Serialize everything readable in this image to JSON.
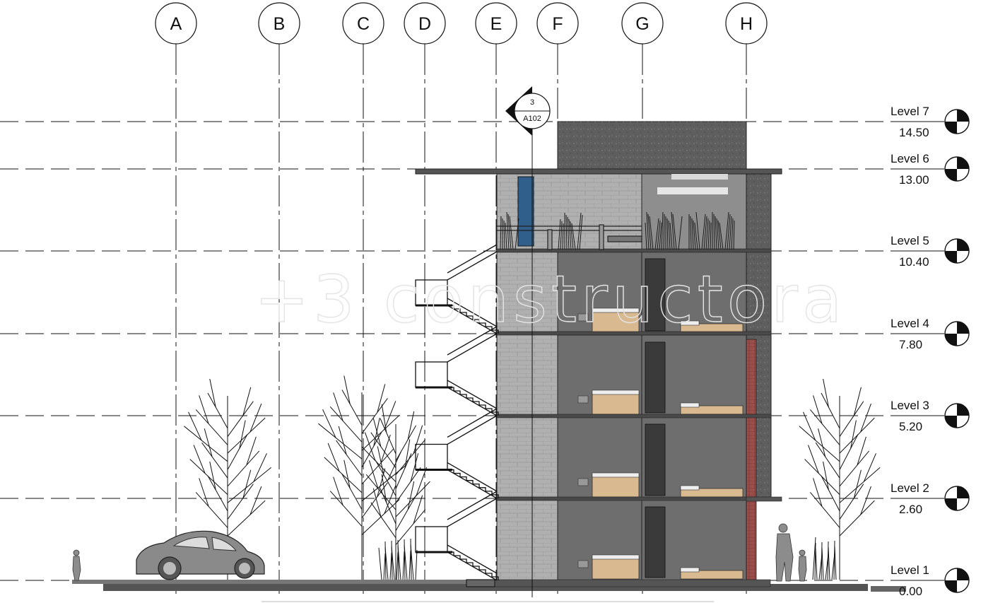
{
  "grids": [
    {
      "label": "A"
    },
    {
      "label": "B"
    },
    {
      "label": "C"
    },
    {
      "label": "D"
    },
    {
      "label": "E"
    },
    {
      "label": "F"
    },
    {
      "label": "G"
    },
    {
      "label": "H"
    }
  ],
  "levels": [
    {
      "name": "Level 7",
      "elevation": "14.50"
    },
    {
      "name": "Level 6",
      "elevation": "13.00"
    },
    {
      "name": "Level 5",
      "elevation": "10.40"
    },
    {
      "name": "Level 4",
      "elevation": "7.80"
    },
    {
      "name": "Level 3",
      "elevation": "5.20"
    },
    {
      "name": "Level 2",
      "elevation": "2.60"
    },
    {
      "name": "Level 1",
      "elevation": "0.00"
    }
  ],
  "section_marker": {
    "number": "3",
    "sheet": "A102"
  },
  "watermark": "+3 constructora",
  "colors": {
    "line": "#111111",
    "slab": "#4a4a4a",
    "block_wall": "#a9a9a9",
    "room_dark": "#6e6e6e",
    "concrete": "#5c5c5c",
    "bed": "#d9b98f",
    "brick_strip": "#9a4f4a",
    "window_blue": "#2f5f8a"
  },
  "icons": [
    "level-head-icon",
    "section-marker-icon",
    "tree-icon",
    "car-icon",
    "person-icon",
    "stair-icon"
  ]
}
